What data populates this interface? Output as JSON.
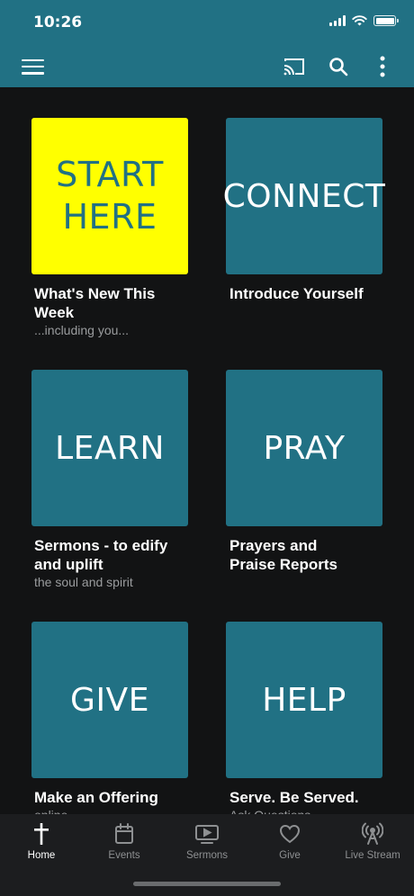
{
  "status_bar": {
    "time": "10:26"
  },
  "toolbar": {
    "menu_icon": "hamburger-menu-icon",
    "cast_icon": "cast-icon",
    "search_icon": "search-icon",
    "more_icon": "more-vertical-icon"
  },
  "tiles": [
    {
      "label": "START HERE",
      "title": "What's New This Week",
      "subtitle": "...including you...",
      "bg": "#ffff00"
    },
    {
      "label": "CONNECT",
      "title": "Introduce Yourself",
      "subtitle": "",
      "bg": "#217184"
    },
    {
      "label": "LEARN",
      "title": "Sermons - to edify and uplift",
      "subtitle": "the soul and spirit",
      "bg": "#217184"
    },
    {
      "label": "PRAY",
      "title": "Prayers and Praise Reports",
      "subtitle": "",
      "bg": "#217184"
    },
    {
      "label": "GIVE",
      "title": "Make an Offering",
      "subtitle": "online",
      "bg": "#217184"
    },
    {
      "label": "HELP",
      "title": "Serve. Be Served.",
      "subtitle": "Ask Questions",
      "bg": "#217184"
    }
  ],
  "tabbar": {
    "active": "Home",
    "tabs": [
      {
        "label": "Home",
        "icon": "cross-icon"
      },
      {
        "label": "Events",
        "icon": "calendar-icon"
      },
      {
        "label": "Sermons",
        "icon": "video-play-icon"
      },
      {
        "label": "Give",
        "icon": "heart-icon"
      },
      {
        "label": "Live Stream",
        "icon": "antenna-icon"
      }
    ]
  },
  "colors": {
    "accent": "#217184",
    "highlight": "#ffff00",
    "background": "#121314",
    "tabbar": "#1c1d1f"
  }
}
